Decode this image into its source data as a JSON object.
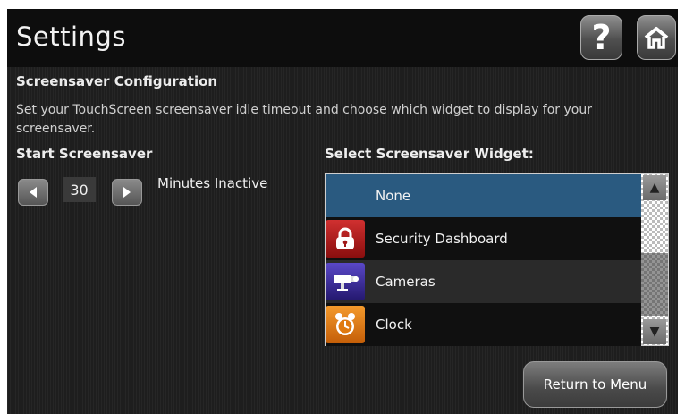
{
  "header": {
    "title": "Settings",
    "help_label": "?"
  },
  "section": {
    "title": "Screensaver Configuration",
    "description": "Set your TouchScreen screensaver idle timeout and choose which widget to display for your screensaver."
  },
  "timeout": {
    "label": "Start Screensaver",
    "value": "30",
    "unit_label": "Minutes Inactive"
  },
  "widget_select": {
    "label": "Select Screensaver Widget:",
    "selected": "None",
    "items": [
      {
        "label": "None",
        "icon": "none"
      },
      {
        "label": "Security Dashboard",
        "icon": "lock-icon"
      },
      {
        "label": "Cameras",
        "icon": "camera-icon"
      },
      {
        "label": "Clock",
        "icon": "alarm-clock-icon"
      }
    ]
  },
  "footer": {
    "return_label": "Return to Menu"
  },
  "colors": {
    "selected_row": "#2a5a80",
    "security_icon_bg": "#b01a1a",
    "camera_icon_bg": "#3a2a9a",
    "clock_icon_bg": "#e07a10"
  }
}
